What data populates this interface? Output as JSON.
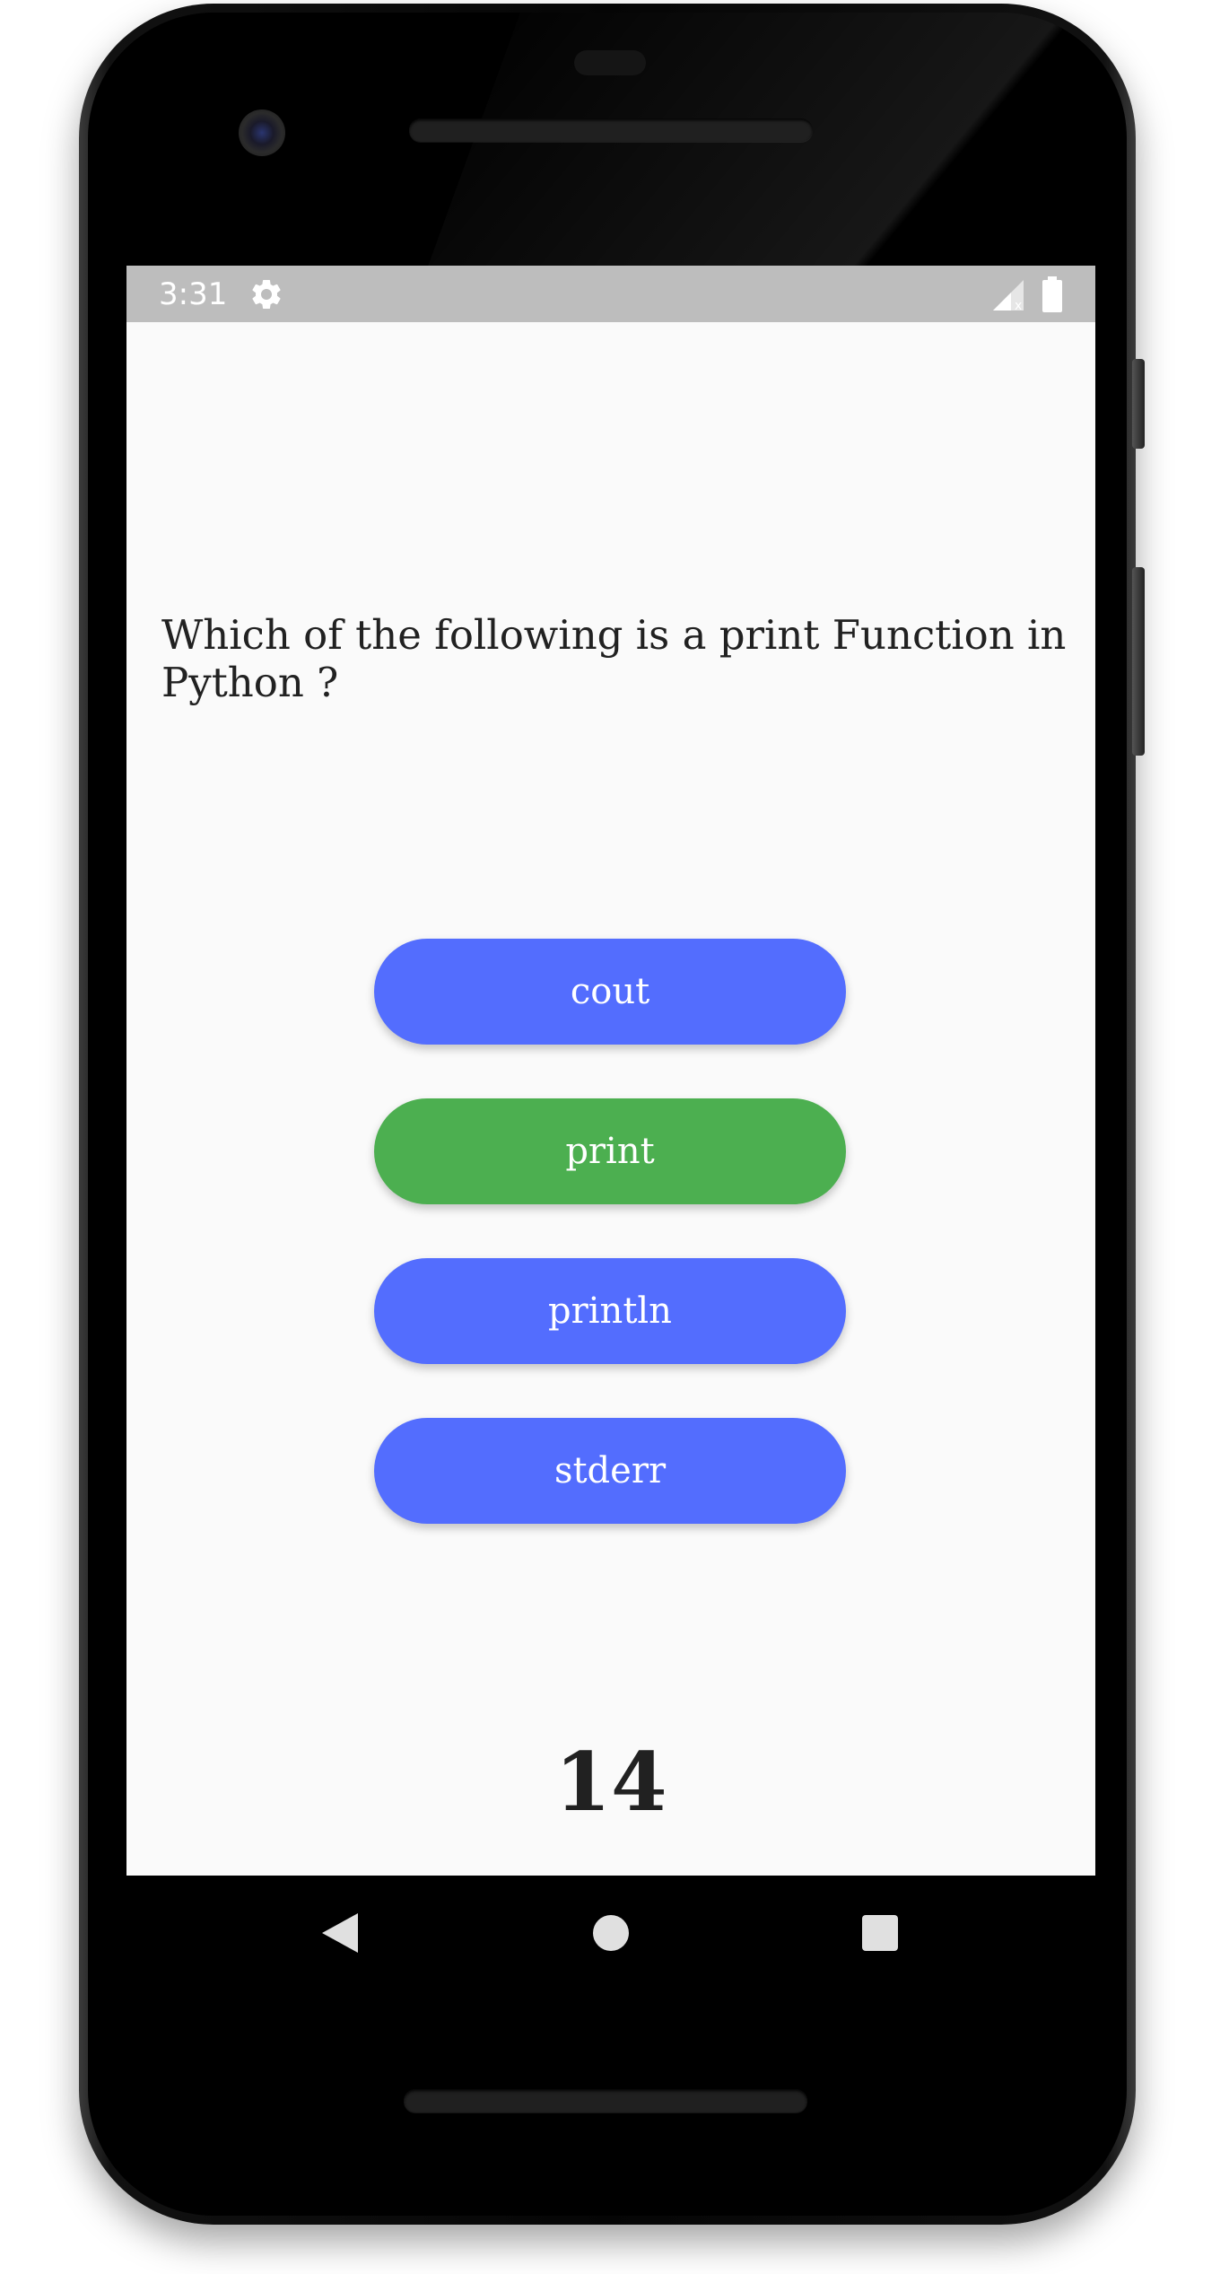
{
  "status_bar": {
    "time": "3:31",
    "icons": [
      "gear-icon",
      "signal-icon",
      "battery-icon"
    ]
  },
  "quiz": {
    "question": "Which of the following is a print Function in Python ?",
    "answers": [
      {
        "label": "cout",
        "state": "default",
        "color": "#536dfe"
      },
      {
        "label": "print",
        "state": "correct",
        "color": "#4caf50"
      },
      {
        "label": "println",
        "state": "default",
        "color": "#536dfe"
      },
      {
        "label": "stderr",
        "state": "default",
        "color": "#536dfe"
      }
    ],
    "score": "14"
  },
  "nav_bar": {
    "icons": [
      "back-icon",
      "home-icon",
      "recents-icon"
    ]
  },
  "colors": {
    "accent_blue": "#536dfe",
    "correct_green": "#4caf50",
    "status_bar": "#bdbdbd",
    "background": "#fafafa"
  }
}
